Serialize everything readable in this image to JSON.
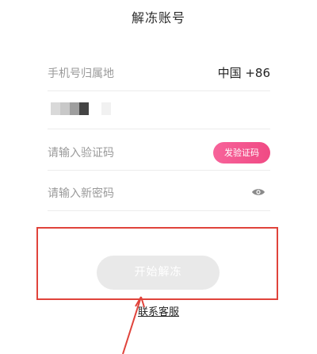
{
  "header": {
    "title": "解冻账号"
  },
  "form": {
    "region_label": "手机号归属地",
    "region_value": "中国 +86",
    "code_placeholder": "请输入验证码",
    "send_code_label": "发验证码",
    "password_placeholder": "请输入新密码",
    "submit_label": "开始解冻"
  },
  "footer": {
    "contact_label": "联系客服"
  },
  "colors": {
    "accent": "#f04a84",
    "annotation": "#e0433b",
    "disabled_button": "#e9e9e9"
  },
  "icons": {
    "password_toggle": "eye-icon"
  }
}
